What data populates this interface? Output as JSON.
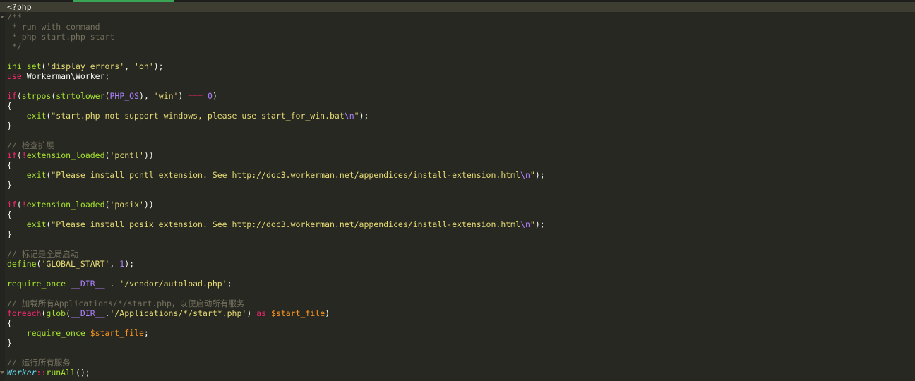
{
  "editor": {
    "theme_colors": {
      "background": "#272822",
      "comment": "#75715e",
      "keyword": "#f92672",
      "function": "#a6e22e",
      "string": "#e6db74",
      "constant": "#ae81ff",
      "variable": "#fd971f",
      "class": "#66d9ef",
      "plain": "#f8f8f2",
      "active_tab_indicator": "#3aa655"
    },
    "language": "php",
    "lines": [
      [
        {
          "t": "<?php",
          "c": "plain"
        }
      ],
      [
        {
          "t": "/**",
          "c": "comment"
        }
      ],
      [
        {
          "t": " * run with command",
          "c": "comment"
        }
      ],
      [
        {
          "t": " * php start.php start",
          "c": "comment"
        }
      ],
      [
        {
          "t": " */",
          "c": "comment"
        }
      ],
      [],
      [
        {
          "t": "ini_set",
          "c": "func"
        },
        {
          "t": "(",
          "c": "plain"
        },
        {
          "t": "'display_errors'",
          "c": "string"
        },
        {
          "t": ", ",
          "c": "plain"
        },
        {
          "t": "'on'",
          "c": "string"
        },
        {
          "t": ");",
          "c": "plain"
        }
      ],
      [
        {
          "t": "use",
          "c": "keyword"
        },
        {
          "t": " Workerman\\Worker;",
          "c": "plain"
        }
      ],
      [],
      [
        {
          "t": "if",
          "c": "keyword"
        },
        {
          "t": "(",
          "c": "plain"
        },
        {
          "t": "strpos",
          "c": "func"
        },
        {
          "t": "(",
          "c": "plain"
        },
        {
          "t": "strtolower",
          "c": "func"
        },
        {
          "t": "(",
          "c": "plain"
        },
        {
          "t": "PHP_OS",
          "c": "const"
        },
        {
          "t": "), ",
          "c": "plain"
        },
        {
          "t": "'win'",
          "c": "string"
        },
        {
          "t": ") ",
          "c": "plain"
        },
        {
          "t": "===",
          "c": "keyword"
        },
        {
          "t": " ",
          "c": "plain"
        },
        {
          "t": "0",
          "c": "const"
        },
        {
          "t": ")",
          "c": "plain"
        }
      ],
      [
        {
          "t": "{",
          "c": "plain"
        }
      ],
      [
        {
          "t": "    ",
          "c": "plain"
        },
        {
          "t": "exit",
          "c": "func"
        },
        {
          "t": "(",
          "c": "plain"
        },
        {
          "t": "\"start.php not support windows, please use start_for_win.bat",
          "c": "string"
        },
        {
          "t": "\\n",
          "c": "const"
        },
        {
          "t": "\"",
          "c": "string"
        },
        {
          "t": ");",
          "c": "plain"
        }
      ],
      [
        {
          "t": "}",
          "c": "plain"
        }
      ],
      [],
      [
        {
          "t": "// 检查扩展",
          "c": "comment"
        }
      ],
      [
        {
          "t": "if",
          "c": "keyword"
        },
        {
          "t": "(",
          "c": "plain"
        },
        {
          "t": "!",
          "c": "keyword"
        },
        {
          "t": "extension_loaded",
          "c": "func"
        },
        {
          "t": "(",
          "c": "plain"
        },
        {
          "t": "'pcntl'",
          "c": "string"
        },
        {
          "t": "))",
          "c": "plain"
        }
      ],
      [
        {
          "t": "{",
          "c": "plain"
        }
      ],
      [
        {
          "t": "    ",
          "c": "plain"
        },
        {
          "t": "exit",
          "c": "func"
        },
        {
          "t": "(",
          "c": "plain"
        },
        {
          "t": "\"Please install pcntl extension. See http://doc3.workerman.net/appendices/install-extension.html",
          "c": "string"
        },
        {
          "t": "\\n",
          "c": "const"
        },
        {
          "t": "\"",
          "c": "string"
        },
        {
          "t": ");",
          "c": "plain"
        }
      ],
      [
        {
          "t": "}",
          "c": "plain"
        }
      ],
      [],
      [
        {
          "t": "if",
          "c": "keyword"
        },
        {
          "t": "(",
          "c": "plain"
        },
        {
          "t": "!",
          "c": "keyword"
        },
        {
          "t": "extension_loaded",
          "c": "func"
        },
        {
          "t": "(",
          "c": "plain"
        },
        {
          "t": "'posix'",
          "c": "string"
        },
        {
          "t": "))",
          "c": "plain"
        }
      ],
      [
        {
          "t": "{",
          "c": "plain"
        }
      ],
      [
        {
          "t": "    ",
          "c": "plain"
        },
        {
          "t": "exit",
          "c": "func"
        },
        {
          "t": "(",
          "c": "plain"
        },
        {
          "t": "\"Please install posix extension. See http://doc3.workerman.net/appendices/install-extension.html",
          "c": "string"
        },
        {
          "t": "\\n",
          "c": "const"
        },
        {
          "t": "\"",
          "c": "string"
        },
        {
          "t": ");",
          "c": "plain"
        }
      ],
      [
        {
          "t": "}",
          "c": "plain"
        }
      ],
      [],
      [
        {
          "t": "// 标记是全局启动",
          "c": "comment"
        }
      ],
      [
        {
          "t": "define",
          "c": "func"
        },
        {
          "t": "(",
          "c": "plain"
        },
        {
          "t": "'GLOBAL_START'",
          "c": "string"
        },
        {
          "t": ", ",
          "c": "plain"
        },
        {
          "t": "1",
          "c": "const"
        },
        {
          "t": ");",
          "c": "plain"
        }
      ],
      [],
      [
        {
          "t": "require_once",
          "c": "func"
        },
        {
          "t": " ",
          "c": "plain"
        },
        {
          "t": "__DIR__",
          "c": "const"
        },
        {
          "t": " . ",
          "c": "plain"
        },
        {
          "t": "'/vendor/autoload.php'",
          "c": "string"
        },
        {
          "t": ";",
          "c": "plain"
        }
      ],
      [],
      [
        {
          "t": "// 加载所有Applications/*/start.php，以便启动所有服务",
          "c": "comment"
        }
      ],
      [
        {
          "t": "foreach",
          "c": "keyword"
        },
        {
          "t": "(",
          "c": "plain"
        },
        {
          "t": "glob",
          "c": "func"
        },
        {
          "t": "(",
          "c": "plain"
        },
        {
          "t": "__DIR__",
          "c": "const"
        },
        {
          "t": ".",
          "c": "plain"
        },
        {
          "t": "'/Applications/*/start*.php'",
          "c": "string"
        },
        {
          "t": ") ",
          "c": "plain"
        },
        {
          "t": "as",
          "c": "keyword"
        },
        {
          "t": " ",
          "c": "plain"
        },
        {
          "t": "$start_file",
          "c": "var"
        },
        {
          "t": ")",
          "c": "plain"
        }
      ],
      [
        {
          "t": "{",
          "c": "plain"
        }
      ],
      [
        {
          "t": "    ",
          "c": "plain"
        },
        {
          "t": "require_once",
          "c": "func"
        },
        {
          "t": " ",
          "c": "plain"
        },
        {
          "t": "$start_file",
          "c": "var"
        },
        {
          "t": ";",
          "c": "plain"
        }
      ],
      [
        {
          "t": "}",
          "c": "plain"
        }
      ],
      [],
      [
        {
          "t": "// 运行所有服务",
          "c": "comment"
        }
      ],
      [
        {
          "t": "Worker",
          "c": "class"
        },
        {
          "t": "::",
          "c": "keyword"
        },
        {
          "t": "runAll",
          "c": "func"
        },
        {
          "t": "();",
          "c": "plain"
        }
      ]
    ]
  }
}
